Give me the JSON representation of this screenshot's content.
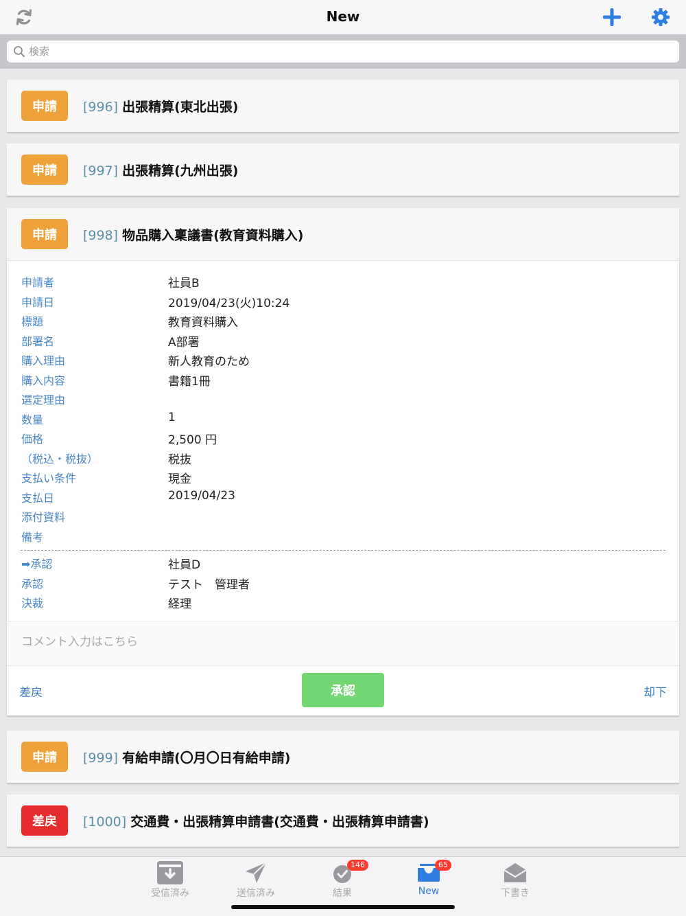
{
  "header": {
    "title": "New",
    "refresh_icon": "refresh-icon",
    "add_icon": "plus-icon",
    "settings_icon": "gear-icon",
    "accent": "#2f7de1"
  },
  "search": {
    "placeholder": "検索",
    "value": ""
  },
  "cards": [
    {
      "status": "申請",
      "status_color": "#f0a23a",
      "number": "[996]",
      "title": "出張精算(東北出張)"
    },
    {
      "status": "申請",
      "status_color": "#f0a23a",
      "number": "[997]",
      "title": "出張精算(九州出張)"
    },
    {
      "status": "申請",
      "status_color": "#f0a23a",
      "number": "[998]",
      "title": "物品購入稟議書(教育資料購入)"
    },
    {
      "status": "申請",
      "status_color": "#f0a23a",
      "number": "[999]",
      "title": "有給申請(〇月〇日有給申請)"
    },
    {
      "status": "差戻",
      "status_color": "#e52b2b",
      "number": "[1000]",
      "title": "交通費・出張精算申請書(交通費・出張精算申請書)"
    }
  ],
  "detail": {
    "fields": [
      {
        "label": "申請者",
        "value": "社員B"
      },
      {
        "label": "申請日",
        "value": "2019/04/23(火)10:24"
      },
      {
        "label": "標題",
        "value": "教育資料購入"
      },
      {
        "label": "部署名",
        "value": "A部署"
      },
      {
        "label": "購入理由",
        "value": "新人教育のため"
      },
      {
        "label": "購入内容",
        "value": "書籍1冊"
      },
      {
        "label": "選定理由",
        "value": ""
      },
      {
        "label": "数量",
        "value": "1"
      },
      {
        "label": "価格",
        "value": "2,500 円"
      },
      {
        "label": "（税込・税抜）",
        "value": "税抜"
      },
      {
        "label": "支払い条件",
        "value": "現金"
      },
      {
        "label": "支払日",
        "value": "2019/04/23"
      },
      {
        "label": "添付資料",
        "value": ""
      },
      {
        "label": "備考",
        "value": ""
      }
    ],
    "route": [
      {
        "label": "➡承認",
        "value": "社員D"
      },
      {
        "label": "承認",
        "value": "テスト　管理者"
      },
      {
        "label": "決裁",
        "value": "経理"
      }
    ],
    "comment_placeholder": "コメント入力はこちら",
    "actions": {
      "return": "差戻",
      "approve": "承認",
      "reject": "却下"
    }
  },
  "tabs": [
    {
      "label": "受信済み",
      "icon": "inbox-download-icon",
      "badge": ""
    },
    {
      "label": "送信済み",
      "icon": "paper-plane-icon",
      "badge": ""
    },
    {
      "label": "結果",
      "icon": "checkmark-circle-icon",
      "badge": "146"
    },
    {
      "label": "New",
      "icon": "tray-icon",
      "badge": "65"
    },
    {
      "label": "下書き",
      "icon": "envelope-open-icon",
      "badge": ""
    }
  ]
}
